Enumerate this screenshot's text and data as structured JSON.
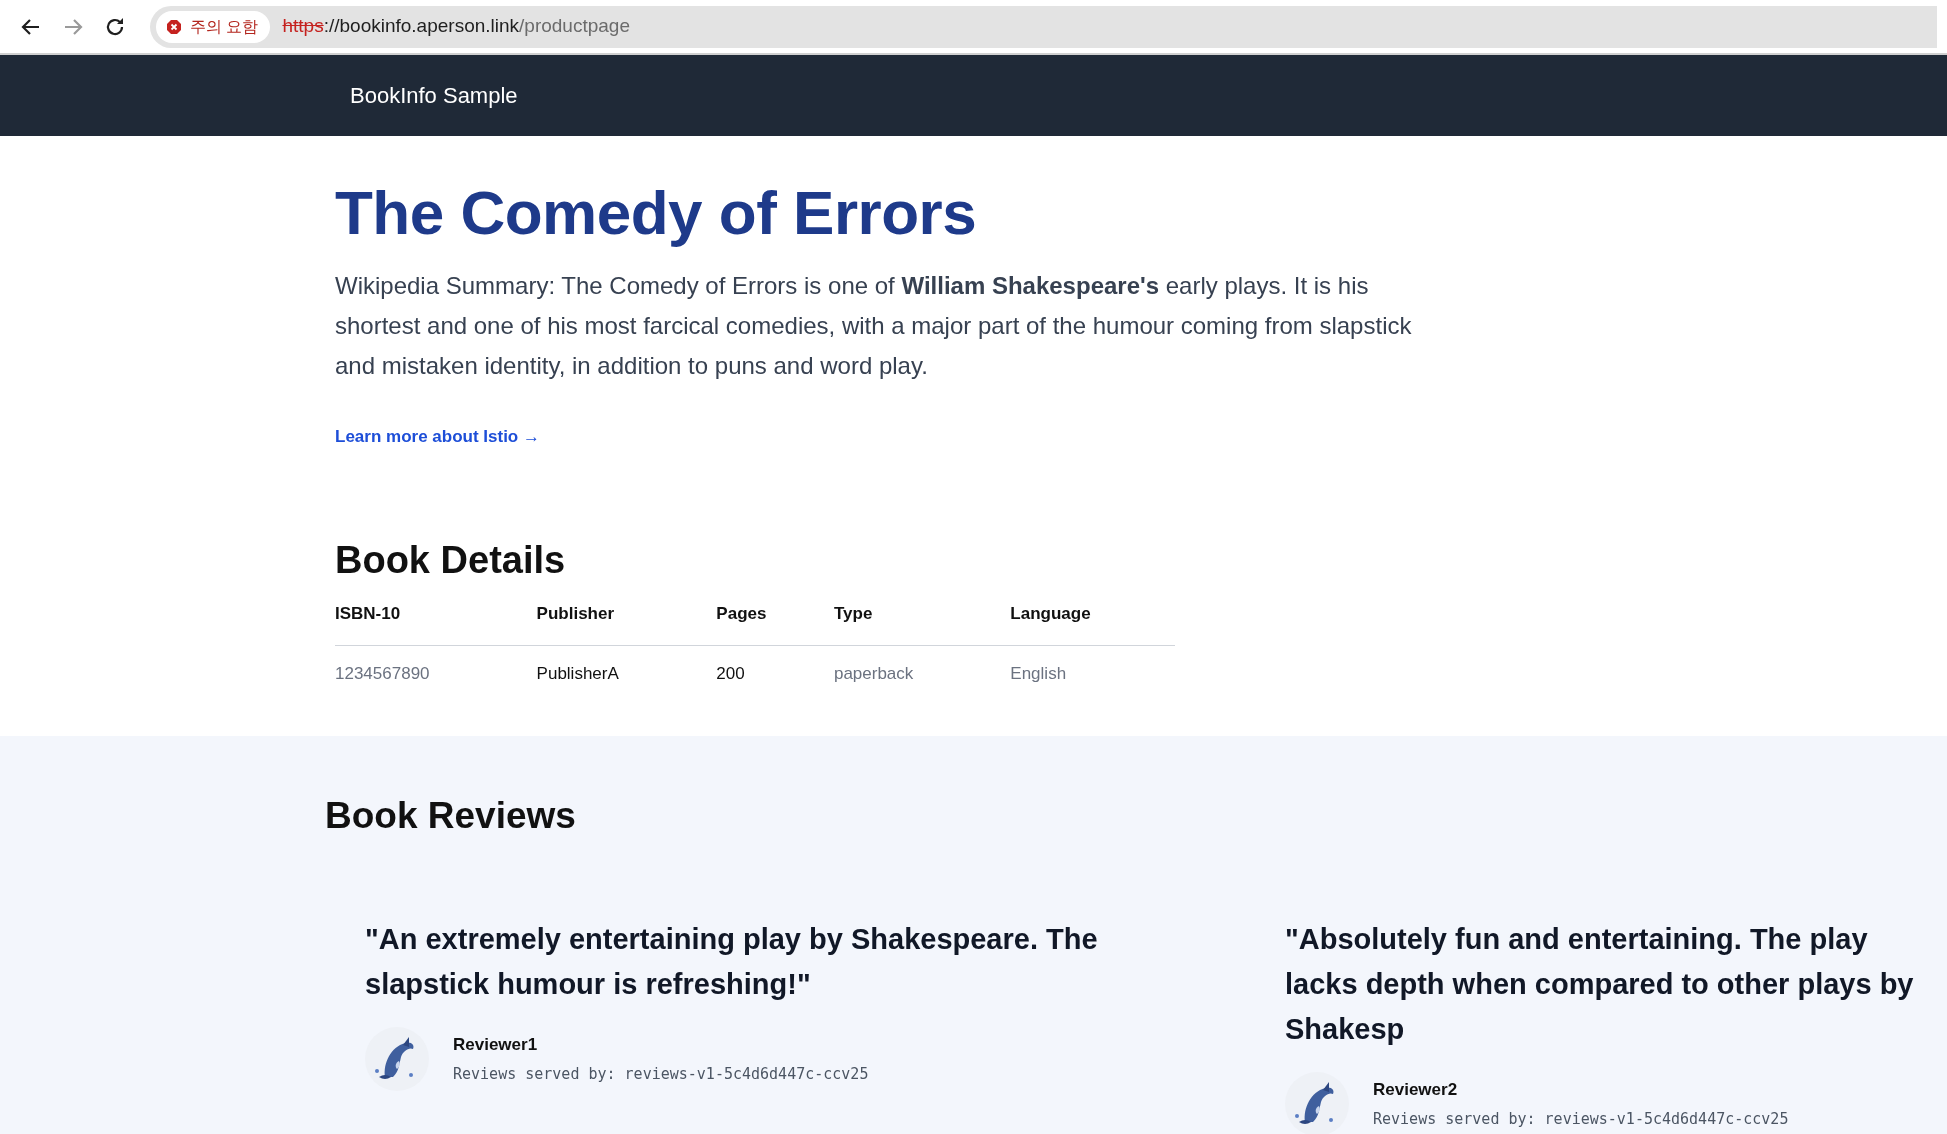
{
  "browser": {
    "nav_buttons": [
      {
        "kind": "back",
        "disabled": false
      },
      {
        "kind": "forward",
        "disabled": true
      },
      {
        "kind": "reload",
        "disabled": false
      }
    ],
    "security_chip": "주의 요함",
    "url": {
      "scheme": "https",
      "host": "://bookinfo.aperson.link",
      "path": "/productpage"
    }
  },
  "navbar": {
    "brand": "BookInfo Sample"
  },
  "product": {
    "title": "The Comedy of Errors",
    "summary": "Wikipedia Summary: The Comedy of Errors is one of **William Shakespeare's** early plays. It is his shortest and one of his most farcical comedies, with a major part of the humour coming from slapstick and mistaken identity, in addition to puns and word play.",
    "link": "Learn more about Istio →"
  },
  "details": {
    "heading": "Book Details",
    "columns": [
      "ISBN-10",
      "Publisher",
      "Pages",
      "Type",
      "Language"
    ],
    "rows": [
      [
        {
          "text": "1234567890",
          "muted": true
        },
        {
          "text": "PublisherA",
          "muted": false
        },
        {
          "text": "200",
          "muted": false
        },
        {
          "text": "paperback",
          "muted": true
        },
        {
          "text": "English",
          "muted": true
        }
      ]
    ]
  },
  "reviews": {
    "heading": "Book Reviews",
    "items": [
      {
        "quote": "\"An extremely entertaining play by Shakespeare. The slapstick humour is refreshing!\"",
        "reviewer": "Reviewer1",
        "served_by": "Reviews served by: reviews-v1-5c4d6d447c-ccv25"
      },
      {
        "quote": "\"Absolutely fun and entertaining. The play lacks depth when compared to other plays by Shakesp",
        "reviewer": "Reviewer2",
        "served_by": "Reviews served by: reviews-v1-5c4d6d447c-ccv25"
      }
    ]
  }
}
